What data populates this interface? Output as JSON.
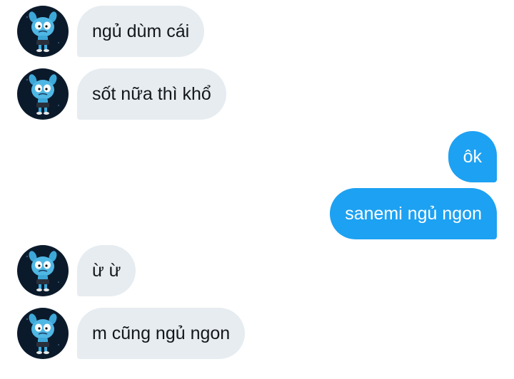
{
  "conversation": {
    "messages": [
      {
        "direction": "incoming",
        "text": "ngủ dùm cái",
        "avatar_icon": "gumball-avatar-icon"
      },
      {
        "direction": "incoming",
        "text": "sốt nữa thì khổ",
        "avatar_icon": "gumball-avatar-icon"
      },
      {
        "direction": "outgoing",
        "text": "ôk"
      },
      {
        "direction": "outgoing",
        "text": "sanemi ngủ ngon"
      },
      {
        "direction": "incoming",
        "text": "ừ ừ",
        "avatar_icon": "gumball-avatar-icon"
      },
      {
        "direction": "incoming",
        "text": "m cũng ngủ ngon",
        "avatar_icon": "gumball-avatar-icon"
      }
    ]
  },
  "colors": {
    "incoming_bubble": "#e6ecf0",
    "outgoing_bubble": "#1da1f2",
    "incoming_text": "#14171a",
    "outgoing_text": "#ffffff",
    "avatar_background": "#0b1a2b"
  }
}
